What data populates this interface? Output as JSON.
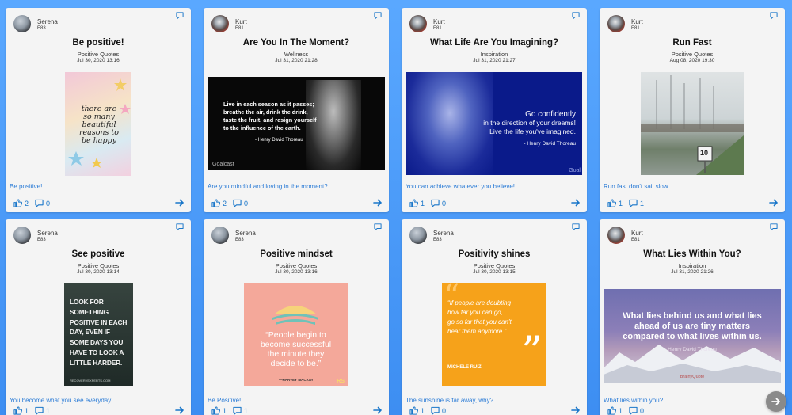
{
  "accent": "#1976c9",
  "cards": [
    {
      "user": "Serena",
      "level": "E83",
      "title": "Be positive!",
      "category": "Positive Quotes",
      "date": "Jul 30, 2020 13:16",
      "caption": "Be positive!",
      "likes": "2",
      "comments": "0",
      "image_text": [
        "there are",
        "so many",
        "beautiful",
        "reasons to",
        "be happy"
      ]
    },
    {
      "user": "Kurt",
      "level": "E81",
      "title": "Are You In The Moment?",
      "category": "Wellness",
      "date": "Jul 31, 2020 21:28",
      "caption": "Are you mindful and loving in the moment?",
      "likes": "2",
      "comments": "0",
      "image_text": [
        "Live in each season as it passes;",
        "breathe the air, drink the drink,",
        "taste the fruit, and resign yourself",
        "to the influence of the earth.",
        "- Henry David Thoreau",
        "Goalcast"
      ]
    },
    {
      "user": "Kurt",
      "level": "E81",
      "title": "What Life Are You Imagining?",
      "category": "Inspiration",
      "date": "Jul 31, 2020 21:27",
      "caption": "You can achieve whatever you believe!",
      "likes": "1",
      "comments": "0",
      "image_text": [
        "Go confidently",
        "in the direction of your dreams!",
        "Live the life you've imagined.",
        "- Henry David Thoreau",
        "Goal"
      ]
    },
    {
      "user": "Kurt",
      "level": "E81",
      "title": "Run Fast",
      "category": "Positive Quotes",
      "date": "Aug 08, 2020 19:30",
      "caption": "Run fast don't sail slow",
      "likes": "1",
      "comments": "1",
      "image_text": [
        "10"
      ]
    },
    {
      "user": "Serena",
      "level": "E83",
      "title": "See positive",
      "category": "Positive Quotes",
      "date": "Jul 30, 2020 13:14",
      "caption": "You become what you see everyday.",
      "likes": "1",
      "comments": "1",
      "image_text": [
        "LOOK FOR",
        "SOMETHING",
        "POSITIVE IN EACH",
        "DAY, EVEN IF",
        "SOME DAYS YOU",
        "HAVE TO LOOK A",
        "LITTLE HARDER.",
        "RECOVERYEXPERTS.COM"
      ]
    },
    {
      "user": "Serena",
      "level": "E83",
      "title": "Positive mindset",
      "category": "Positive Quotes",
      "date": "Jul 30, 2020 13:16",
      "caption": "Be Positive!",
      "likes": "1",
      "comments": "1",
      "image_text": [
        "“People begin to",
        "become successful",
        "the minute they",
        "decide to be.”",
        "—HARVEY MACKAY",
        "RS"
      ]
    },
    {
      "user": "Serena",
      "level": "E83",
      "title": "Positivity shines",
      "category": "Positive Quotes",
      "date": "Jul 30, 2020 13:15",
      "caption": "The sunshine is far away, why?",
      "likes": "1",
      "comments": "0",
      "image_text": [
        "“If people are doubting",
        "how far you can go,",
        "go so far that you can't",
        "hear them anymore.”",
        "MICHELE RUIZ"
      ]
    },
    {
      "user": "Kurt",
      "level": "E81",
      "title": "What Lies Within You?",
      "category": "Inspiration",
      "date": "Jul 31, 2020 21:26",
      "caption": "What lies within you?",
      "likes": "1",
      "comments": "0",
      "image_text": [
        "What lies behind us and what lies",
        "ahead of us are tiny matters",
        "compared to what lives within us.",
        "Henry David Thoreau",
        "BrainyQuote"
      ]
    }
  ]
}
